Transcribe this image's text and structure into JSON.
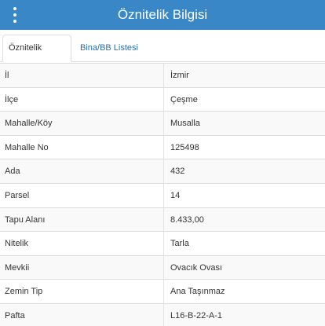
{
  "header": {
    "title": "Öznitelik Bilgisi",
    "menu_icon": "vertical-dots-icon"
  },
  "tabs": [
    {
      "label": "Öznitelik Bilgisi",
      "active": true
    },
    {
      "label": "Bina/BB Listesi",
      "active": false
    }
  ],
  "rows": [
    {
      "key": "İl",
      "value": "İzmir"
    },
    {
      "key": "İlçe",
      "value": "Çeşme"
    },
    {
      "key": "Mahalle/Köy",
      "value": "Musalla"
    },
    {
      "key": "Mahalle No",
      "value": "125498"
    },
    {
      "key": "Ada",
      "value": "432"
    },
    {
      "key": "Parsel",
      "value": "14"
    },
    {
      "key": "Tapu Alanı",
      "value": "8.433,00"
    },
    {
      "key": "Nitelik",
      "value": "Tarla"
    },
    {
      "key": "Mevkii",
      "value": "Ovacık Ovası"
    },
    {
      "key": "Zemin Tip",
      "value": "Ana Taşınmaz"
    },
    {
      "key": "Pafta",
      "value": "L16-B-22-A-1"
    }
  ],
  "colors": {
    "header_bg": "#3a87c8",
    "tab_link": "#2a6fb0"
  }
}
